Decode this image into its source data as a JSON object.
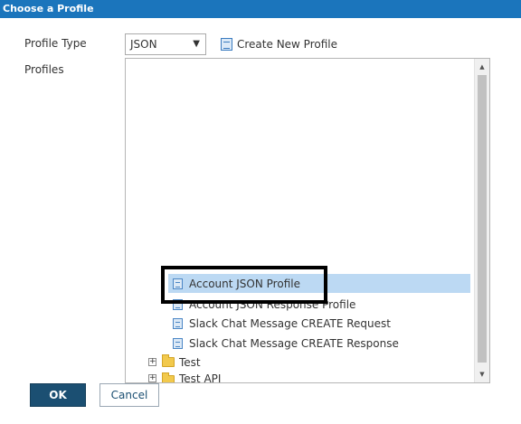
{
  "dialog": {
    "title": "Choose a Profile"
  },
  "form": {
    "profile_type_label": "Profile Type",
    "profile_type_value": "JSON",
    "create_link": "Create New Profile",
    "profiles_label": "Profiles"
  },
  "tree": {
    "items": [
      {
        "label": "Account JSON Profile",
        "type": "profile",
        "selected": true
      },
      {
        "label": "Account JSON Response Profile",
        "type": "profile",
        "selected": false
      },
      {
        "label": "Slack Chat Message CREATE Request",
        "type": "profile",
        "selected": false
      },
      {
        "label": "Slack Chat Message CREATE Response",
        "type": "profile",
        "selected": false
      },
      {
        "label": "Test",
        "type": "folder",
        "selected": false
      },
      {
        "label": "Test API",
        "type": "folder",
        "selected": false
      }
    ]
  },
  "buttons": {
    "ok": "OK",
    "cancel": "Cancel"
  },
  "colors": {
    "title_bar": "#1b75bc",
    "selected_row": "#bcd9f3",
    "ok_button": "#1b4f72",
    "highlight_box": "#000000"
  }
}
